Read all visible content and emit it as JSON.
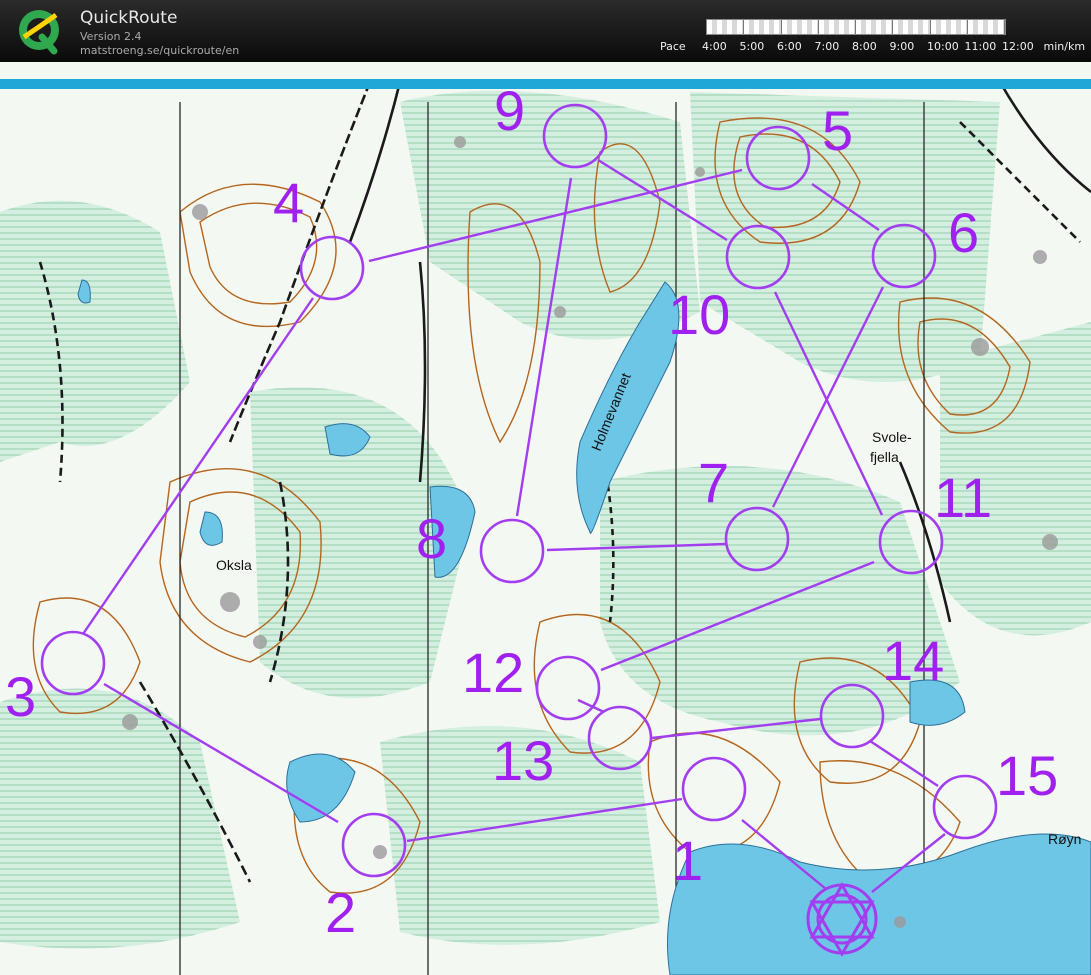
{
  "app": {
    "title": "QuickRoute",
    "version": "Version 2.4",
    "url": "matstroeng.se/quickroute/en",
    "logo_letter": "Q"
  },
  "pace": {
    "label": "Pace",
    "ticks": [
      "4:00",
      "5:00",
      "6:00",
      "7:00",
      "8:00",
      "9:00",
      "10:00",
      "11:00",
      "12:00"
    ],
    "unit": "min/km"
  },
  "map": {
    "place_names": [
      "Holmevannet",
      "Okslа",
      "Svole-",
      "fjella",
      "Røyn"
    ],
    "controls": [
      "1",
      "2",
      "3",
      "4",
      "5",
      "6",
      "7",
      "8",
      "9",
      "10",
      "11",
      "12",
      "13",
      "14",
      "15"
    ],
    "colors": {
      "course": "#a23ef0",
      "control_number": "#a020f0",
      "water": "#6ec6e6",
      "vegetation": "#c9ead6",
      "contour": "#b5651d",
      "accent_bar": "#1fa7d8"
    }
  }
}
